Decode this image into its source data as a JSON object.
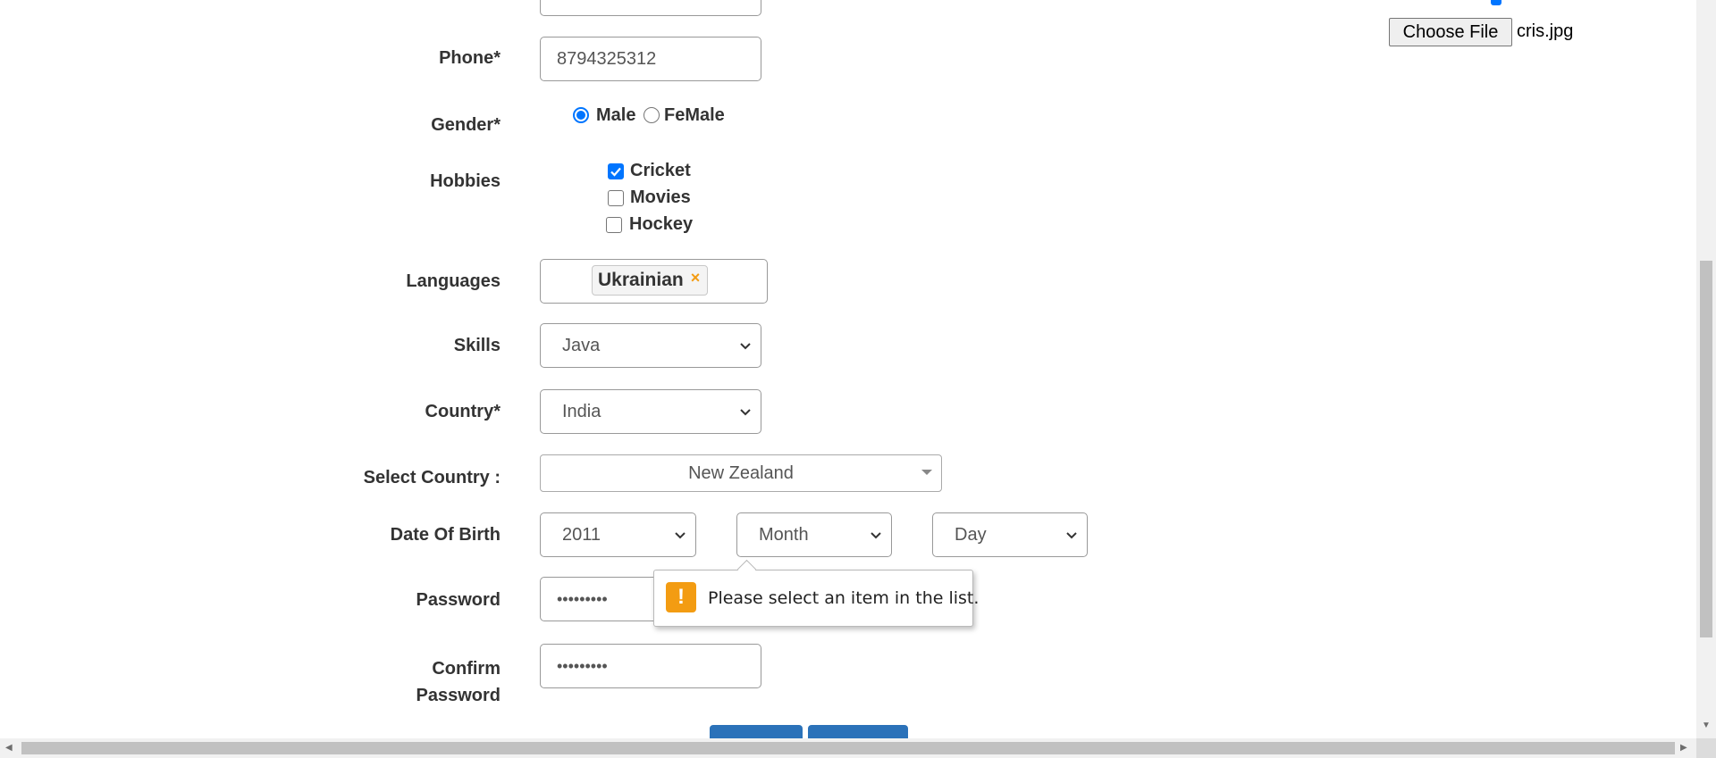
{
  "file_upload": {
    "button_label": "Choose File",
    "filename": "cris.jpg"
  },
  "form": {
    "phone": {
      "label": "Phone*",
      "value": "8794325312"
    },
    "gender": {
      "label": "Gender*",
      "options": [
        "Male",
        "FeMale"
      ],
      "selected": "Male"
    },
    "hobbies": {
      "label": "Hobbies",
      "options": [
        {
          "label": "Cricket",
          "checked": true
        },
        {
          "label": "Movies",
          "checked": false
        },
        {
          "label": "Hockey",
          "checked": false
        }
      ]
    },
    "languages": {
      "label": "Languages",
      "tag": "Ukrainian",
      "remove_glyph": "×"
    },
    "skills": {
      "label": "Skills",
      "value": "Java"
    },
    "country": {
      "label": "Country*",
      "value": "India"
    },
    "select_country": {
      "label": "Select Country :",
      "value": "New Zealand"
    },
    "dob": {
      "label": "Date Of Birth",
      "year": "2011",
      "month": "Month",
      "day": "Day"
    },
    "password": {
      "label": "Password",
      "value": "•••••••••"
    },
    "confirm_password": {
      "label_line1": "Confirm",
      "label_line2": "Password",
      "value": "•••••••••"
    }
  },
  "validation_tooltip": {
    "icon": "!",
    "message": "Please select an item in the list."
  },
  "colors": {
    "accent": "#0075ff",
    "warning": "#f39c12",
    "button": "#2b72b9"
  },
  "icons": {
    "select_chevron": "chevron-down-icon",
    "warning": "warning-icon",
    "tag_remove": "close-icon"
  }
}
